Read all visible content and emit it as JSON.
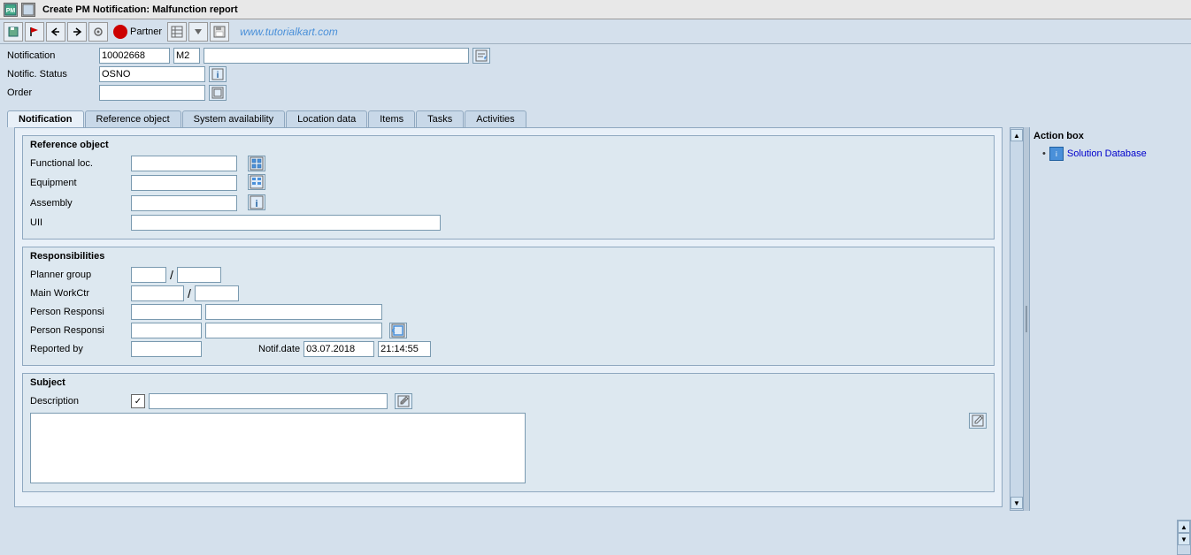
{
  "title_bar": {
    "icon": "PM",
    "text": "Create PM Notification: Malfunction report"
  },
  "toolbar": {
    "buttons": [
      "⬛",
      "🚩",
      "↩",
      "↪",
      "⚙",
      "●",
      "Partner",
      "▤",
      "▼",
      "💾"
    ],
    "partner_label": "Partner",
    "watermark": "www.tutorialkart.com"
  },
  "form": {
    "notification_label": "Notification",
    "notification_value": "10002668",
    "notification_type": "M2",
    "notif_status_label": "Notific. Status",
    "notif_status_value": "OSNO",
    "order_label": "Order"
  },
  "tabs": [
    {
      "id": "notification",
      "label": "Notification",
      "active": true
    },
    {
      "id": "reference_object",
      "label": "Reference object"
    },
    {
      "id": "system_availability",
      "label": "System availability"
    },
    {
      "id": "location_data",
      "label": "Location data"
    },
    {
      "id": "items",
      "label": "Items"
    },
    {
      "id": "tasks",
      "label": "Tasks"
    },
    {
      "id": "activities",
      "label": "Activities"
    }
  ],
  "reference_object_section": {
    "title": "Reference object",
    "fields": [
      {
        "label": "Functional loc.",
        "id": "func_loc"
      },
      {
        "label": "Equipment",
        "id": "equipment"
      },
      {
        "label": "Assembly",
        "id": "assembly"
      },
      {
        "label": "UII",
        "id": "uii",
        "wide": true
      }
    ]
  },
  "responsibilities_section": {
    "title": "Responsibilities",
    "planner_group_label": "Planner group",
    "main_workctr_label": "Main WorkCtr",
    "person_responsi_label1": "Person Responsi",
    "person_responsi_label2": "Person Responsi",
    "reported_by_label": "Reported by",
    "notif_date_label": "Notif.date",
    "notif_date_value": "03.07.2018",
    "notif_time_value": "21:14:55"
  },
  "subject_section": {
    "title": "Subject",
    "description_label": "Description"
  },
  "action_box": {
    "title": "Action box",
    "items": [
      {
        "label": "Solution Database",
        "icon": "i"
      }
    ]
  }
}
